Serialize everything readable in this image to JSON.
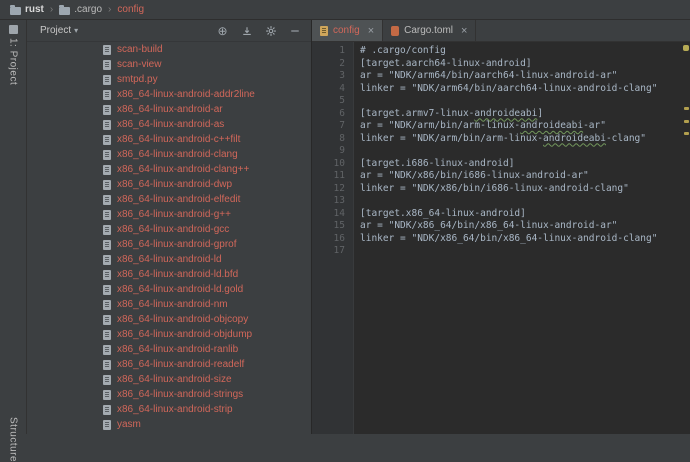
{
  "colors": {
    "panel_bg": "#3c3f41",
    "editor_bg": "#2b2b2b",
    "gutter_bg": "#313335",
    "unversioned_file": "#d1675a",
    "editor_text": "#a9b7c6",
    "line_number": "#606366",
    "active_tab_bg": "#4e5254",
    "warning_stripe": "#b3a04f"
  },
  "breadcrumb": {
    "separator": "›",
    "path": [
      {
        "label": "rust",
        "icon": "folder-icon"
      },
      {
        "label": ".cargo",
        "icon": "folder-icon"
      },
      {
        "label": "config",
        "icon": null
      }
    ]
  },
  "left_stripe": {
    "top_button": {
      "label": "1: Project"
    },
    "bottom_button": {
      "label": "Structure"
    }
  },
  "project_panel": {
    "title": "Project",
    "caret_glyph": "▾",
    "toolbar": {
      "locate_glyph": "⊕",
      "icons": [
        "locate-icon",
        "collapse-all-icon",
        "settings-icon",
        "hide-icon"
      ]
    },
    "files": [
      "scan-build",
      "scan-view",
      "smtpd.py",
      "x86_64-linux-android-addr2line",
      "x86_64-linux-android-ar",
      "x86_64-linux-android-as",
      "x86_64-linux-android-c++filt",
      "x86_64-linux-android-clang",
      "x86_64-linux-android-clang++",
      "x86_64-linux-android-dwp",
      "x86_64-linux-android-elfedit",
      "x86_64-linux-android-g++",
      "x86_64-linux-android-gcc",
      "x86_64-linux-android-gprof",
      "x86_64-linux-android-ld",
      "x86_64-linux-android-ld.bfd",
      "x86_64-linux-android-ld.gold",
      "x86_64-linux-android-nm",
      "x86_64-linux-android-objcopy",
      "x86_64-linux-android-objdump",
      "x86_64-linux-android-ranlib",
      "x86_64-linux-android-readelf",
      "x86_64-linux-android-size",
      "x86_64-linux-android-strings",
      "x86_64-linux-android-strip",
      "yasm"
    ]
  },
  "editor": {
    "close_glyph": "×",
    "tabs": [
      {
        "label": "config",
        "active": true,
        "icon": "config-file-icon",
        "unversioned": true
      },
      {
        "label": "Cargo.toml",
        "active": false,
        "icon": "cargo-file-icon",
        "unversioned": false
      }
    ],
    "lines": [
      {
        "num": "1",
        "text": "# .cargo/config"
      },
      {
        "num": "2",
        "text": "[target.aarch64-linux-android]"
      },
      {
        "num": "3",
        "text": "ar = \"NDK/arm64/bin/aarch64-linux-android-ar\""
      },
      {
        "num": "4",
        "text": "linker = \"NDK/arm64/bin/aarch64-linux-android-clang\""
      },
      {
        "num": "5",
        "text": ""
      },
      {
        "num": "6",
        "text": "[target.armv7-linux-androideabi]",
        "typos": [
          "androideabi"
        ]
      },
      {
        "num": "7",
        "text": "ar = \"NDK/arm/bin/arm-linux-androideabi-ar\"",
        "typos": [
          "androideabi"
        ]
      },
      {
        "num": "8",
        "text": "linker = \"NDK/arm/bin/arm-linux-androideabi-clang\"",
        "typos": [
          "androideabi"
        ]
      },
      {
        "num": "9",
        "text": ""
      },
      {
        "num": "10",
        "text": "[target.i686-linux-android]"
      },
      {
        "num": "11",
        "text": "ar = \"NDK/x86/bin/i686-linux-android-ar\""
      },
      {
        "num": "12",
        "text": "linker = \"NDK/x86/bin/i686-linux-android-clang\""
      },
      {
        "num": "13",
        "text": ""
      },
      {
        "num": "14",
        "text": "[target.x86_64-linux-android]"
      },
      {
        "num": "15",
        "text": "ar = \"NDK/x86_64/bin/x86_64-linux-android-ar\""
      },
      {
        "num": "16",
        "text": "linker = \"NDK/x86_64/bin/x86_64-linux-android-clang\""
      },
      {
        "num": "17",
        "text": ""
      }
    ]
  }
}
